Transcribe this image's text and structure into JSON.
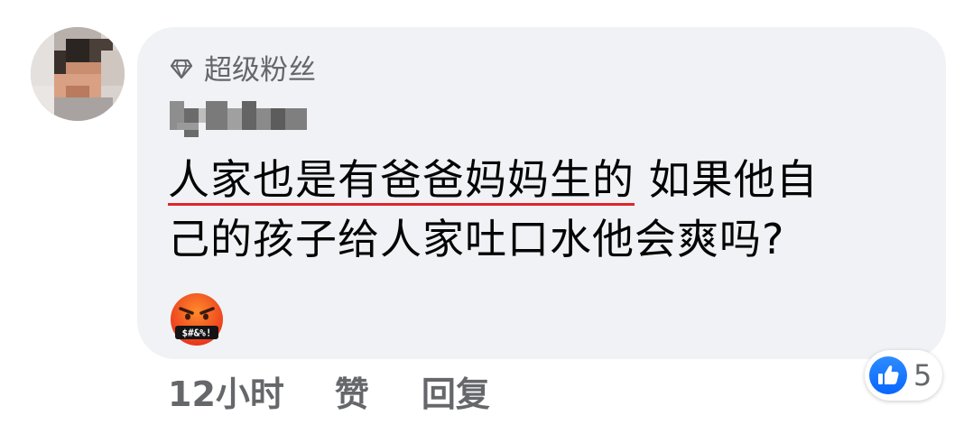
{
  "comment": {
    "badge": {
      "icon": "diamond-icon",
      "label": "超级粉丝"
    },
    "author_name": "Cj Chin",
    "text_underlined": "人家也是有爸爸妈妈生的",
    "text_line1_rest": " 如果他自",
    "text_line2": "己的孩子给人家吐口水他会爽吗?",
    "emoji": {
      "icon": "face-with-symbols-on-mouth-icon",
      "symbols": "$#&%!"
    },
    "underline_color": "#e0262d",
    "bubble_color": "#f0f2f5"
  },
  "actions": {
    "time": "12小时",
    "like": "赞",
    "reply": "回复"
  },
  "reactions": {
    "icon": "thumbs-up-icon",
    "count": "5",
    "color": "#1877f2"
  }
}
